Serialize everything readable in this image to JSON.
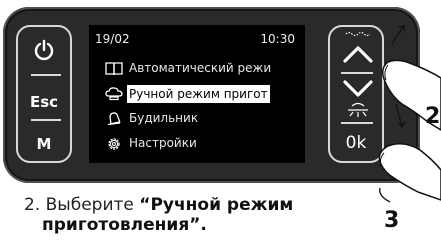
{
  "left_panel": {
    "power_icon": "power-icon",
    "esc_label": "Esc",
    "m_label": "M"
  },
  "screen": {
    "date": "19/02",
    "time": "10:30",
    "menu": [
      {
        "label": "Автоматический режи",
        "icon": "book-icon",
        "selected": false
      },
      {
        "label": "Ручной режим пригот",
        "icon": "cloud-icon",
        "selected": true
      },
      {
        "label": "Будильник",
        "icon": "bell-icon",
        "selected": false
      },
      {
        "label": "Настройки",
        "icon": "gear-icon",
        "selected": false
      }
    ]
  },
  "right_panel": {
    "up_icon": "chevron-up-icon",
    "down_icon": "chevron-down-icon",
    "light_icon": "light-icon",
    "ok_label": "0k"
  },
  "caption": {
    "prefix": "2. Выберите ",
    "bold_line1": "“Ручной режим",
    "bold_line2": "приготовления”."
  },
  "steps": {
    "step2": "2",
    "step3": "3"
  },
  "colors": {
    "device": "#2a2a2a",
    "screen": "#000000",
    "outline": "#d9d9d9"
  }
}
